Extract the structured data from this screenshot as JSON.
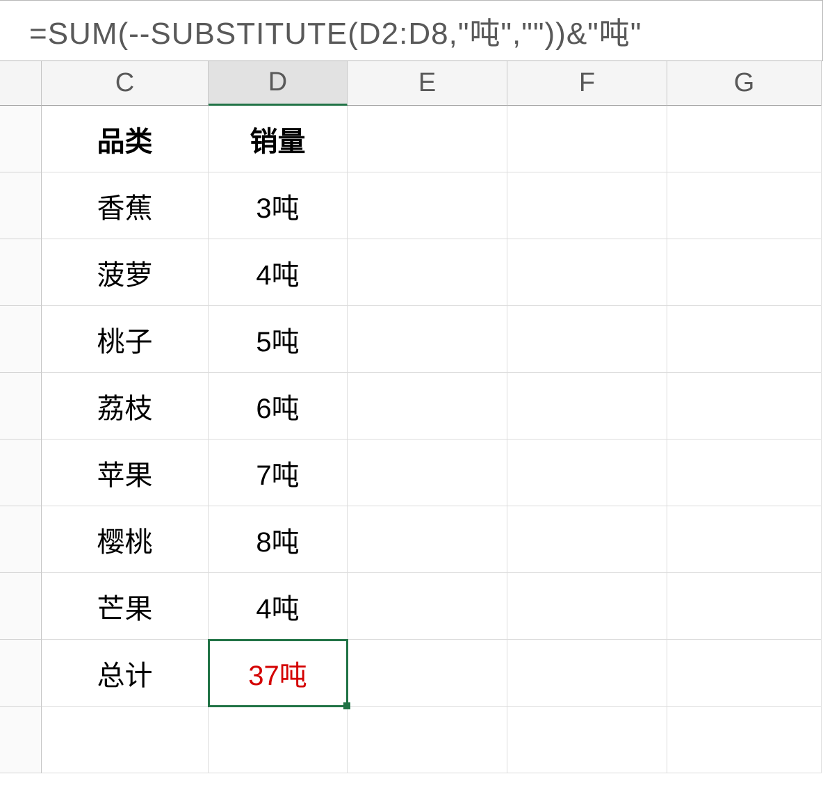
{
  "formula_bar": {
    "text": "=SUM(--SUBSTITUTE(D2:D8,\"吨\",\"\"))&\"吨\""
  },
  "columns": [
    "C",
    "D",
    "E",
    "F",
    "G"
  ],
  "active_column": "D",
  "selected_cell": "D9",
  "chart_data": {
    "type": "table",
    "headers": {
      "c": "品类",
      "d": "销量"
    },
    "rows": [
      {
        "c": "香蕉",
        "d": "3吨"
      },
      {
        "c": "菠萝",
        "d": "4吨"
      },
      {
        "c": "桃子",
        "d": "5吨"
      },
      {
        "c": "荔枝",
        "d": "6吨"
      },
      {
        "c": "苹果",
        "d": "7吨"
      },
      {
        "c": "樱桃",
        "d": "8吨"
      },
      {
        "c": "芒果",
        "d": "4吨"
      }
    ],
    "total": {
      "c": "总计",
      "d": "37吨"
    }
  }
}
